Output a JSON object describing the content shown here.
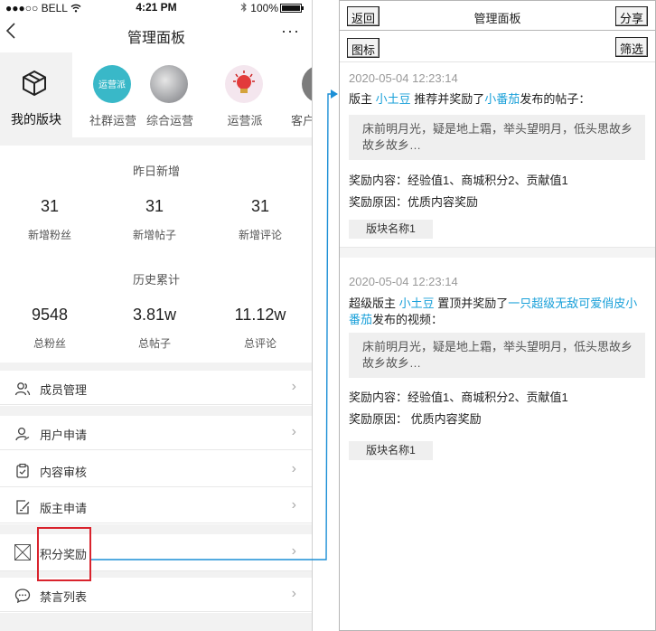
{
  "status_bar": {
    "carrier": "●●●○○ BELL",
    "time": "4:21 PM",
    "battery": "100%"
  },
  "left_panel": {
    "title": "管理面板",
    "back_icon": "chevron-left",
    "more_label": "···",
    "my_block_label": "我的版块",
    "blocks": [
      {
        "label": "社群运营",
        "icon_text": "运营派",
        "color": "#39b8c8"
      },
      {
        "label": "综合运营",
        "color": "#a9aaad"
      },
      {
        "label": "运营派",
        "color": "#f4e6ee"
      },
      {
        "label": "客户",
        "color": "#7c7c7c"
      }
    ],
    "stats_yesterday": {
      "title": "昨日新增",
      "items": [
        {
          "value": "31",
          "label": "新增粉丝"
        },
        {
          "value": "31",
          "label": "新增帖子"
        },
        {
          "value": "31",
          "label": "新增评论"
        }
      ]
    },
    "stats_history": {
      "title": "历史累计",
      "items": [
        {
          "value": "9548",
          "label": "总粉丝"
        },
        {
          "value": "3.81w",
          "label": "总帖子"
        },
        {
          "value": "11.12w",
          "label": "总评论"
        }
      ]
    },
    "menu": {
      "members": "成员管理",
      "user_apply": "用户申请",
      "content_review": "内容审核",
      "moderator_apply": "版主申请",
      "points_reward": "积分奖励",
      "ban_list": "禁言列表",
      "arrow": "›"
    }
  },
  "right_panel": {
    "back": "返回",
    "title": "管理面板",
    "share": "分享",
    "legend": "图标",
    "filter": "筛选",
    "posts": [
      {
        "time": "2020-05-04 12:23:14",
        "role": "版主",
        "user": "小土豆",
        "action": "推荐并奖励了",
        "target": "小番茄",
        "suffix": "发布的帖子：",
        "quote": "床前明月光，疑是地上霜，举头望明月，低头思故乡故乡故乡…",
        "reward_content": "奖励内容：经验值1、商城积分2、贡献值1",
        "reward_reason": "奖励原因：优质内容奖励",
        "tag": "版块名称1"
      },
      {
        "time": "2020-05-04 12:23:14",
        "role": "超级版主",
        "user": "小土豆",
        "action": "置顶并奖励了",
        "target": "一只超级无敌可爱俏皮小番茄",
        "suffix": "发布的视频：",
        "quote": "床前明月光，疑是地上霜，举头望明月，低头思故乡故乡故乡…",
        "reward_content": "奖励内容：经验值1、商城积分2、贡献值1",
        "reward_reason": "奖励原因： 优质内容奖励",
        "tag": "版块名称1"
      }
    ]
  },
  "colors": {
    "accent": "#19a0d9",
    "highlight": "#d9232d",
    "connector": "#1c8fd6"
  }
}
